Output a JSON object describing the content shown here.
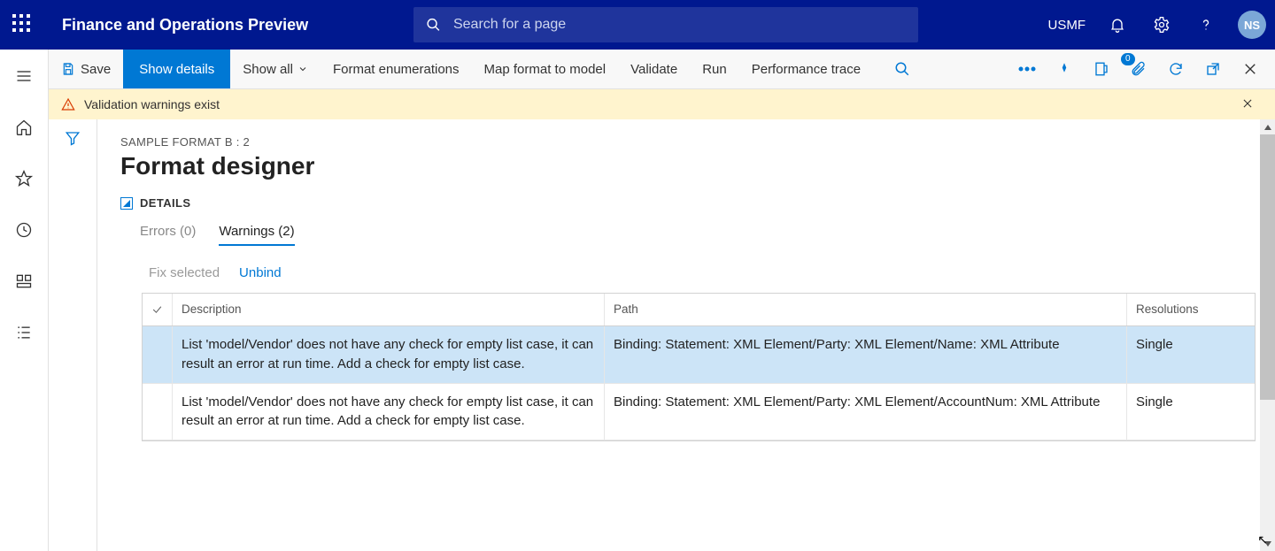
{
  "header": {
    "app_title": "Finance and Operations Preview",
    "search_placeholder": "Search for a page",
    "company": "USMF",
    "avatar_initials": "NS"
  },
  "toolbar": {
    "save": "Save",
    "show_details": "Show details",
    "show_all": "Show all",
    "format_enum": "Format enumerations",
    "map_model": "Map format to model",
    "validate": "Validate",
    "run": "Run",
    "perf_trace": "Performance trace",
    "attachment_badge": "0"
  },
  "warning_bar": {
    "text": "Validation warnings exist"
  },
  "page": {
    "crumb": "SAMPLE FORMAT B : 2",
    "title": "Format designer",
    "details_label": "DETAILS",
    "tabs": {
      "errors": "Errors (0)",
      "warnings": "Warnings (2)"
    },
    "row_actions": {
      "fix": "Fix selected",
      "unbind": "Unbind"
    },
    "grid": {
      "headers": {
        "description": "Description",
        "path": "Path",
        "resolutions": "Resolutions"
      },
      "rows": [
        {
          "description": "List 'model/Vendor' does not have any check for empty list case, it can result an error at run time. Add a check for empty list case.",
          "path": "Binding: Statement: XML Element/Party: XML Element/Name: XML Attribute",
          "resolutions": "Single",
          "selected": true
        },
        {
          "description": "List 'model/Vendor' does not have any check for empty list case, it can result an error at run time. Add a check for empty list case.",
          "path": "Binding: Statement: XML Element/Party: XML Element/AccountNum: XML Attribute",
          "resolutions": "Single",
          "selected": false
        }
      ]
    }
  }
}
